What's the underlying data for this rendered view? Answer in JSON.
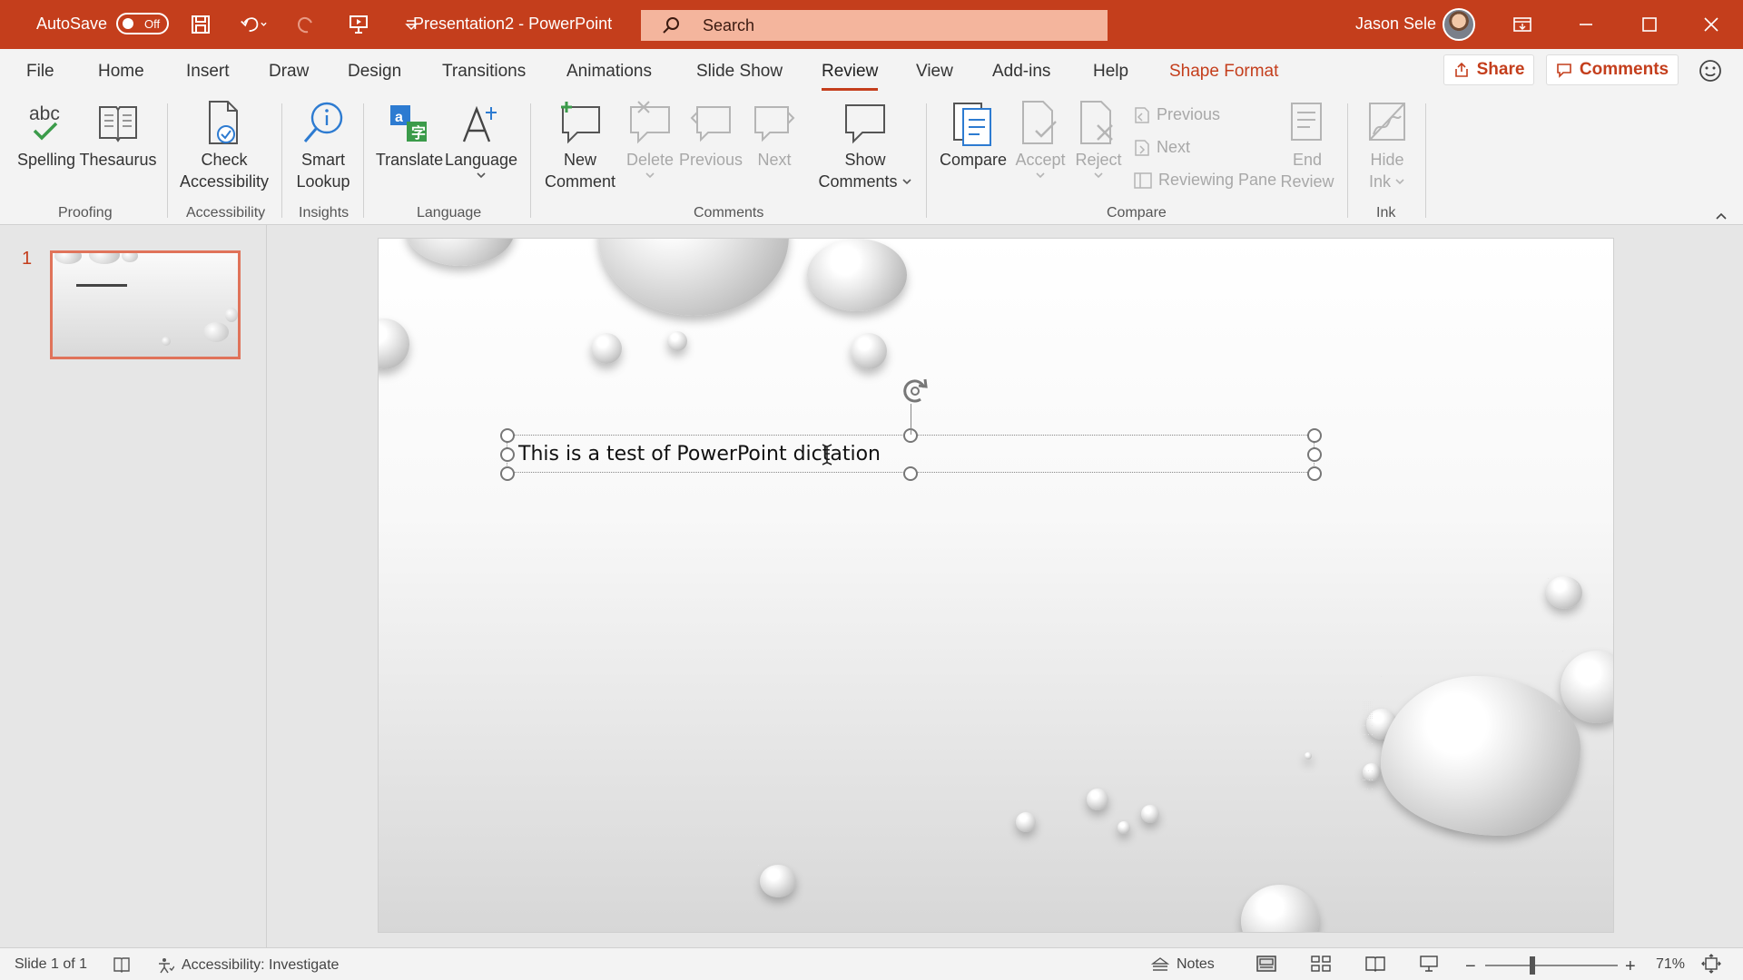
{
  "colors": {
    "accent": "#c43e1c",
    "accent_light": "#f4b59d",
    "ribbon_bg": "#f3f3f3",
    "canvas_bg": "#e6e6e6"
  },
  "titlebar": {
    "autosave_label": "AutoSave",
    "autosave_state": "Off",
    "document_title": "Presentation2  -  PowerPoint",
    "search_placeholder": "Search",
    "user_name": "Jason Sele"
  },
  "tabs": [
    "File",
    "Home",
    "Insert",
    "Draw",
    "Design",
    "Transitions",
    "Animations",
    "Slide Show",
    "Review",
    "View",
    "Add-ins",
    "Help",
    "Shape Format"
  ],
  "active_tab": "Review",
  "share_label": "Share",
  "comments_label": "Comments",
  "ribbon": {
    "proofing": {
      "label": "Proofing",
      "spelling": "Spelling",
      "thesaurus": "Thesaurus",
      "spelling_icon_text": "abc"
    },
    "accessibility": {
      "label": "Accessibility",
      "check_line1": "Check",
      "check_line2": "Accessibility"
    },
    "insights": {
      "label": "Insights",
      "smart_line1": "Smart",
      "smart_line2": "Lookup"
    },
    "language": {
      "label": "Language",
      "translate": "Translate",
      "language": "Language"
    },
    "comments": {
      "label": "Comments",
      "new_line1": "New",
      "new_line2": "Comment",
      "delete": "Delete",
      "previous": "Previous",
      "next": "Next",
      "show_line1": "Show",
      "show_line2": "Comments"
    },
    "compare": {
      "label": "Compare",
      "compare": "Compare",
      "accept": "Accept",
      "reject": "Reject",
      "previous": "Previous",
      "next": "Next",
      "reviewing_pane": "Reviewing Pane",
      "end_line1": "End",
      "end_line2": "Review"
    },
    "ink": {
      "label": "Ink",
      "hide_line1": "Hide",
      "hide_line2": "Ink"
    }
  },
  "slides_pane": {
    "slide_number": "1"
  },
  "slide": {
    "textbox_text": "This is a test of PowerPoint dictation"
  },
  "statusbar": {
    "slide_info": "Slide 1 of 1",
    "accessibility": "Accessibility: Investigate",
    "notes": "Notes",
    "zoom_minus": "−",
    "zoom_plus": "+",
    "zoom_level": "71%"
  }
}
